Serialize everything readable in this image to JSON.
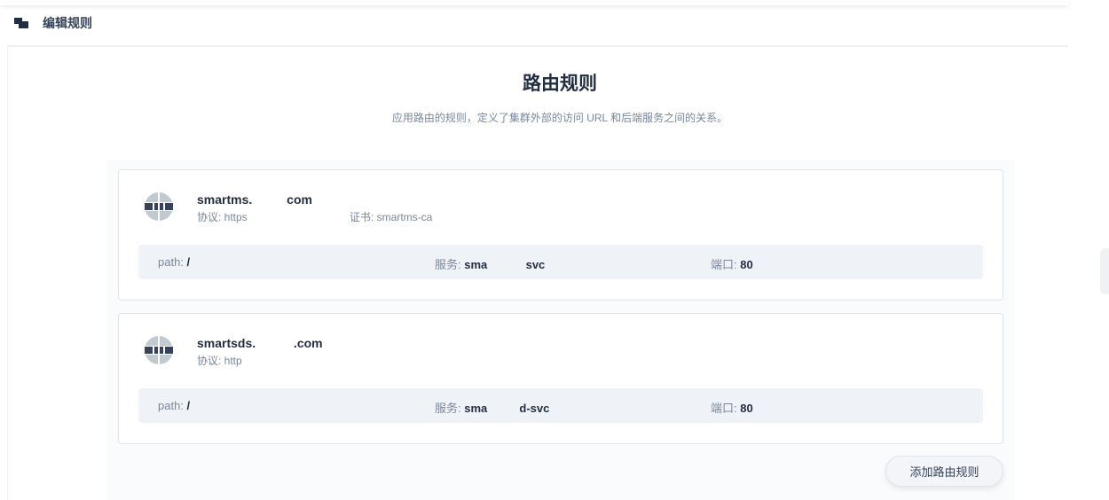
{
  "header": {
    "title": "编辑规则"
  },
  "main": {
    "title": "路由规则",
    "description": "应用路由的规则，定义了集群外部的访问 URL 和后端服务之间的关系。",
    "rules": [
      {
        "host": "smartms.          com",
        "protocol": "协议: https",
        "certificate": "证书: smartms-ca",
        "path_label": "path: ",
        "path": "/",
        "service_label": "服务: ",
        "service": "sma            svc",
        "port_label": "端口: ",
        "port": "80"
      },
      {
        "host": "smartsds.           .com",
        "protocol": "协议: http",
        "path_label": "path: ",
        "path": "/",
        "service_label": "服务: ",
        "service": "sma          d-svc",
        "port_label": "端口: ",
        "port": "80"
      }
    ],
    "add_button": "添加路由规则"
  }
}
